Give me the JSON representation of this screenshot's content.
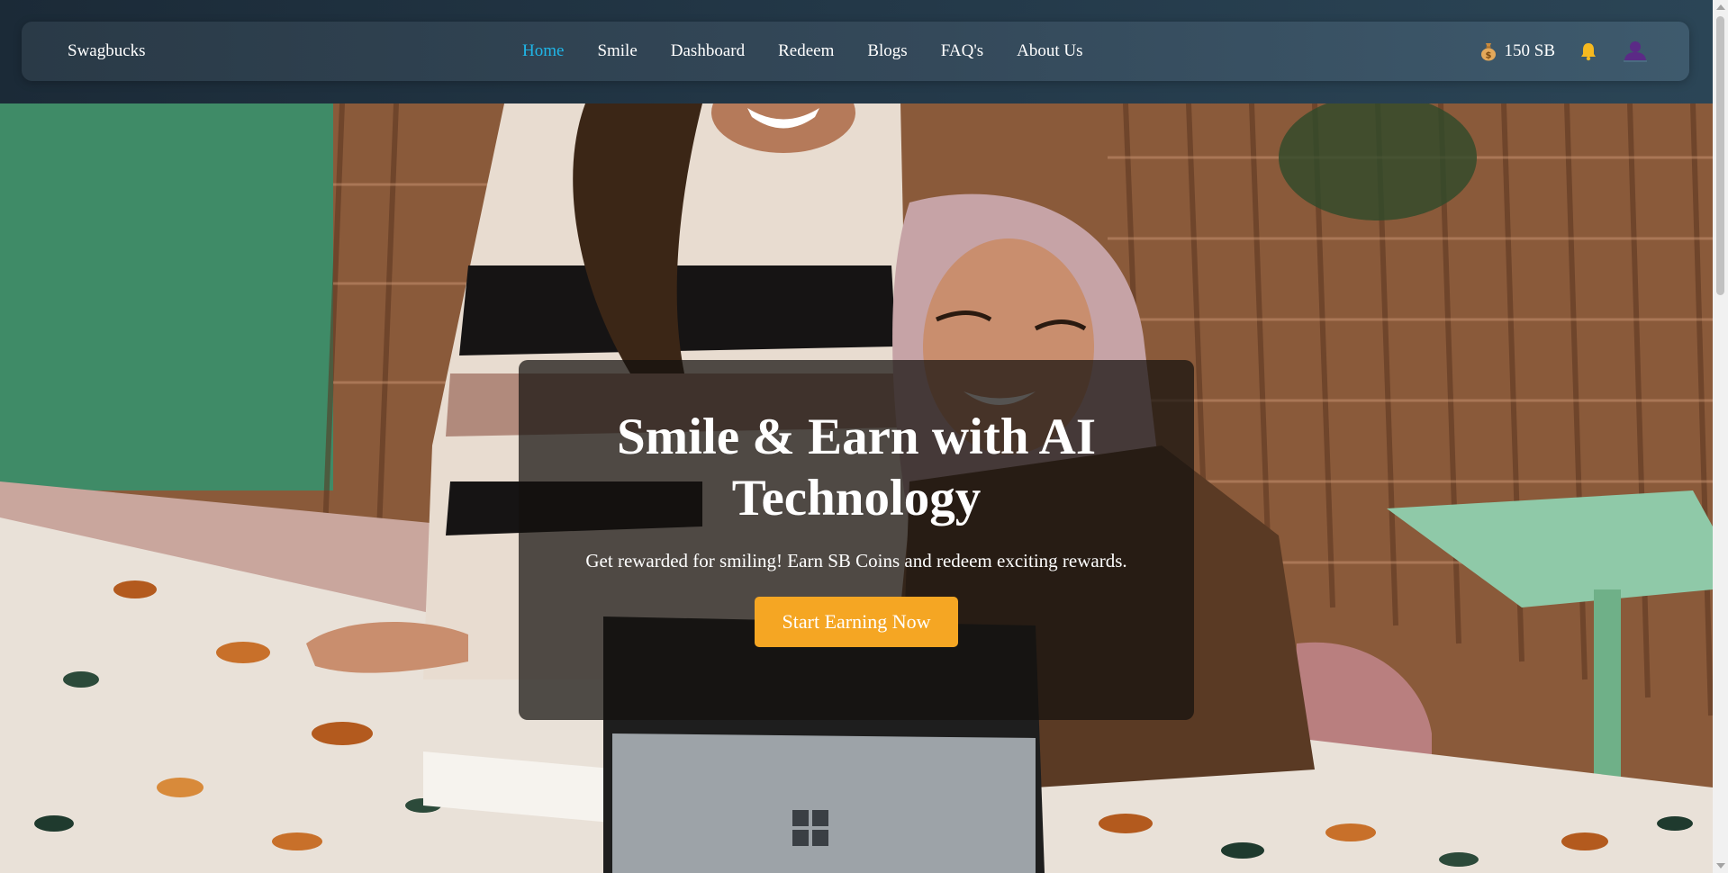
{
  "header": {
    "brand": "Swagbucks",
    "nav": [
      {
        "label": "Home",
        "active": true
      },
      {
        "label": "Smile",
        "active": false
      },
      {
        "label": "Dashboard",
        "active": false
      },
      {
        "label": "Redeem",
        "active": false
      },
      {
        "label": "Blogs",
        "active": false
      },
      {
        "label": "FAQ's",
        "active": false
      },
      {
        "label": "About Us",
        "active": false
      }
    ],
    "coins": "150 SB",
    "icons": {
      "coins": "money-bag-icon",
      "notifications": "bell-icon",
      "profile": "user-avatar-icon"
    }
  },
  "hero": {
    "title": "Smile & Earn with AI Technology",
    "subtitle": "Get rewarded for smiling! Earn SB Coins and redeem exciting rewards.",
    "cta_label": "Start Earning Now"
  },
  "colors": {
    "active_link": "#1fb6e8",
    "cta": "#f5a623",
    "navbar": "#34495a"
  }
}
